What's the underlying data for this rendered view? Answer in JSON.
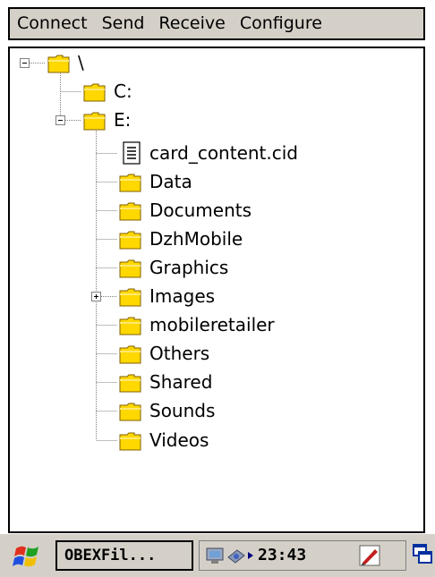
{
  "menu": {
    "items": [
      {
        "label": "Connect"
      },
      {
        "label": "Send"
      },
      {
        "label": "Receive"
      },
      {
        "label": "Configure"
      }
    ]
  },
  "tree": {
    "root": {
      "label": "\\",
      "expanded": true
    },
    "drives": [
      {
        "label": "C:"
      },
      {
        "label": "E:",
        "expanded": true
      }
    ],
    "items": [
      {
        "label": "card_content.cid",
        "type": "file"
      },
      {
        "label": "Data",
        "type": "folder"
      },
      {
        "label": "Documents",
        "type": "folder"
      },
      {
        "label": "DzhMobile",
        "type": "folder"
      },
      {
        "label": "Graphics",
        "type": "folder"
      },
      {
        "label": "Images",
        "type": "folder",
        "collapsed": true
      },
      {
        "label": "mobileretailer",
        "type": "folder"
      },
      {
        "label": "Others",
        "type": "folder"
      },
      {
        "label": "Shared",
        "type": "folder"
      },
      {
        "label": "Sounds",
        "type": "folder"
      },
      {
        "label": "Videos",
        "type": "folder"
      }
    ]
  },
  "taskbar": {
    "app_label": "OBEXFil...",
    "clock": "23:43"
  },
  "colors": {
    "folder": "#ffd800",
    "chrome": "#d4d0c8"
  }
}
